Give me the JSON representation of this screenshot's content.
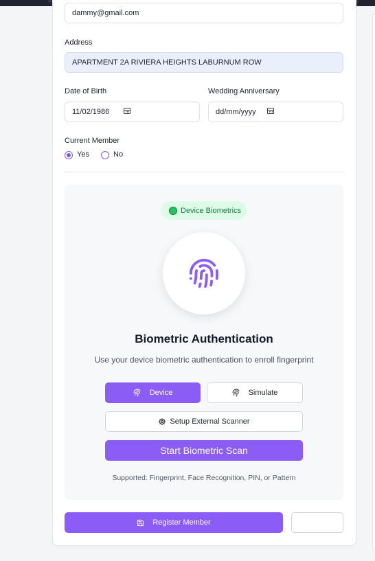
{
  "form": {
    "email_value": "dammy@gmail.com",
    "address_label": "Address",
    "address_value": "APARTMENT 2A RIVIERA HEIGHTS LABURNUM ROW",
    "dob_label": "Date of Birth",
    "dob_value": "11/02/1986",
    "anniversary_label": "Wedding Anniversary",
    "anniversary_value": "dd/mm/yyyy",
    "current_member_label": "Current Member",
    "yes_label": "Yes",
    "no_label": "No",
    "current_member_selected": "Yes"
  },
  "biometric": {
    "badge_label": "Device Biometrics",
    "title": "Biometric Authentication",
    "subtitle": "Use your device biometric authentication to enroll fingerprint",
    "device_button": "Device",
    "simulate_button": "Simulate",
    "external_button": "Setup External Scanner",
    "start_button": "Start Biometric Scan",
    "supported_text": "Supported: Fingerprint, Face Recognition, PIN, or Pattern"
  },
  "footer": {
    "register_button": "Register Member",
    "secondary_button": ""
  },
  "colors": {
    "accent": "#8b5cf6",
    "badge_bg": "#dcfce7",
    "badge_text": "#15803d",
    "address_bg": "#e9effb"
  }
}
